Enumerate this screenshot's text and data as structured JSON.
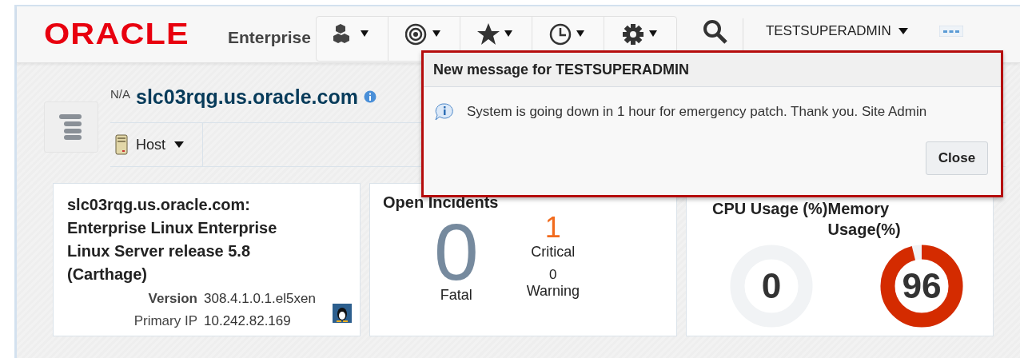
{
  "header": {
    "logo": "ORACLE",
    "product": "Enterprise",
    "user_menu": "TESTSUPERADMIN"
  },
  "target": {
    "status": "N/A",
    "name": "slc03rqg.us.oracle.com",
    "menu": "Host"
  },
  "summary": {
    "title": "slc03rqg.us.oracle.com: Enterprise Linux Enterprise Linux Server release 5.8 (Carthage)",
    "fields": [
      {
        "label": "Version",
        "value": "308.4.1.0.1.el5xen"
      },
      {
        "label": "Primary IP",
        "value": "10.242.82.169"
      }
    ]
  },
  "incidents": {
    "title": "Open Incidents",
    "fatal": {
      "count": "0",
      "label": "Fatal"
    },
    "critical": {
      "count": "1",
      "label": "Critical"
    },
    "warning": {
      "count": "0",
      "label": "Warning"
    }
  },
  "usage": {
    "gauges": [
      {
        "label": "CPU Usage (%)",
        "reading": "0",
        "level": 0
      },
      {
        "label": "Memory Usage(%)",
        "reading": "96",
        "level": 0.96
      }
    ]
  },
  "dialog": {
    "title": "New message for TESTSUPERADMIN",
    "message": "System is going down in 1 hour for emergency patch. Thank you. Site Admin",
    "button": "Close"
  }
}
